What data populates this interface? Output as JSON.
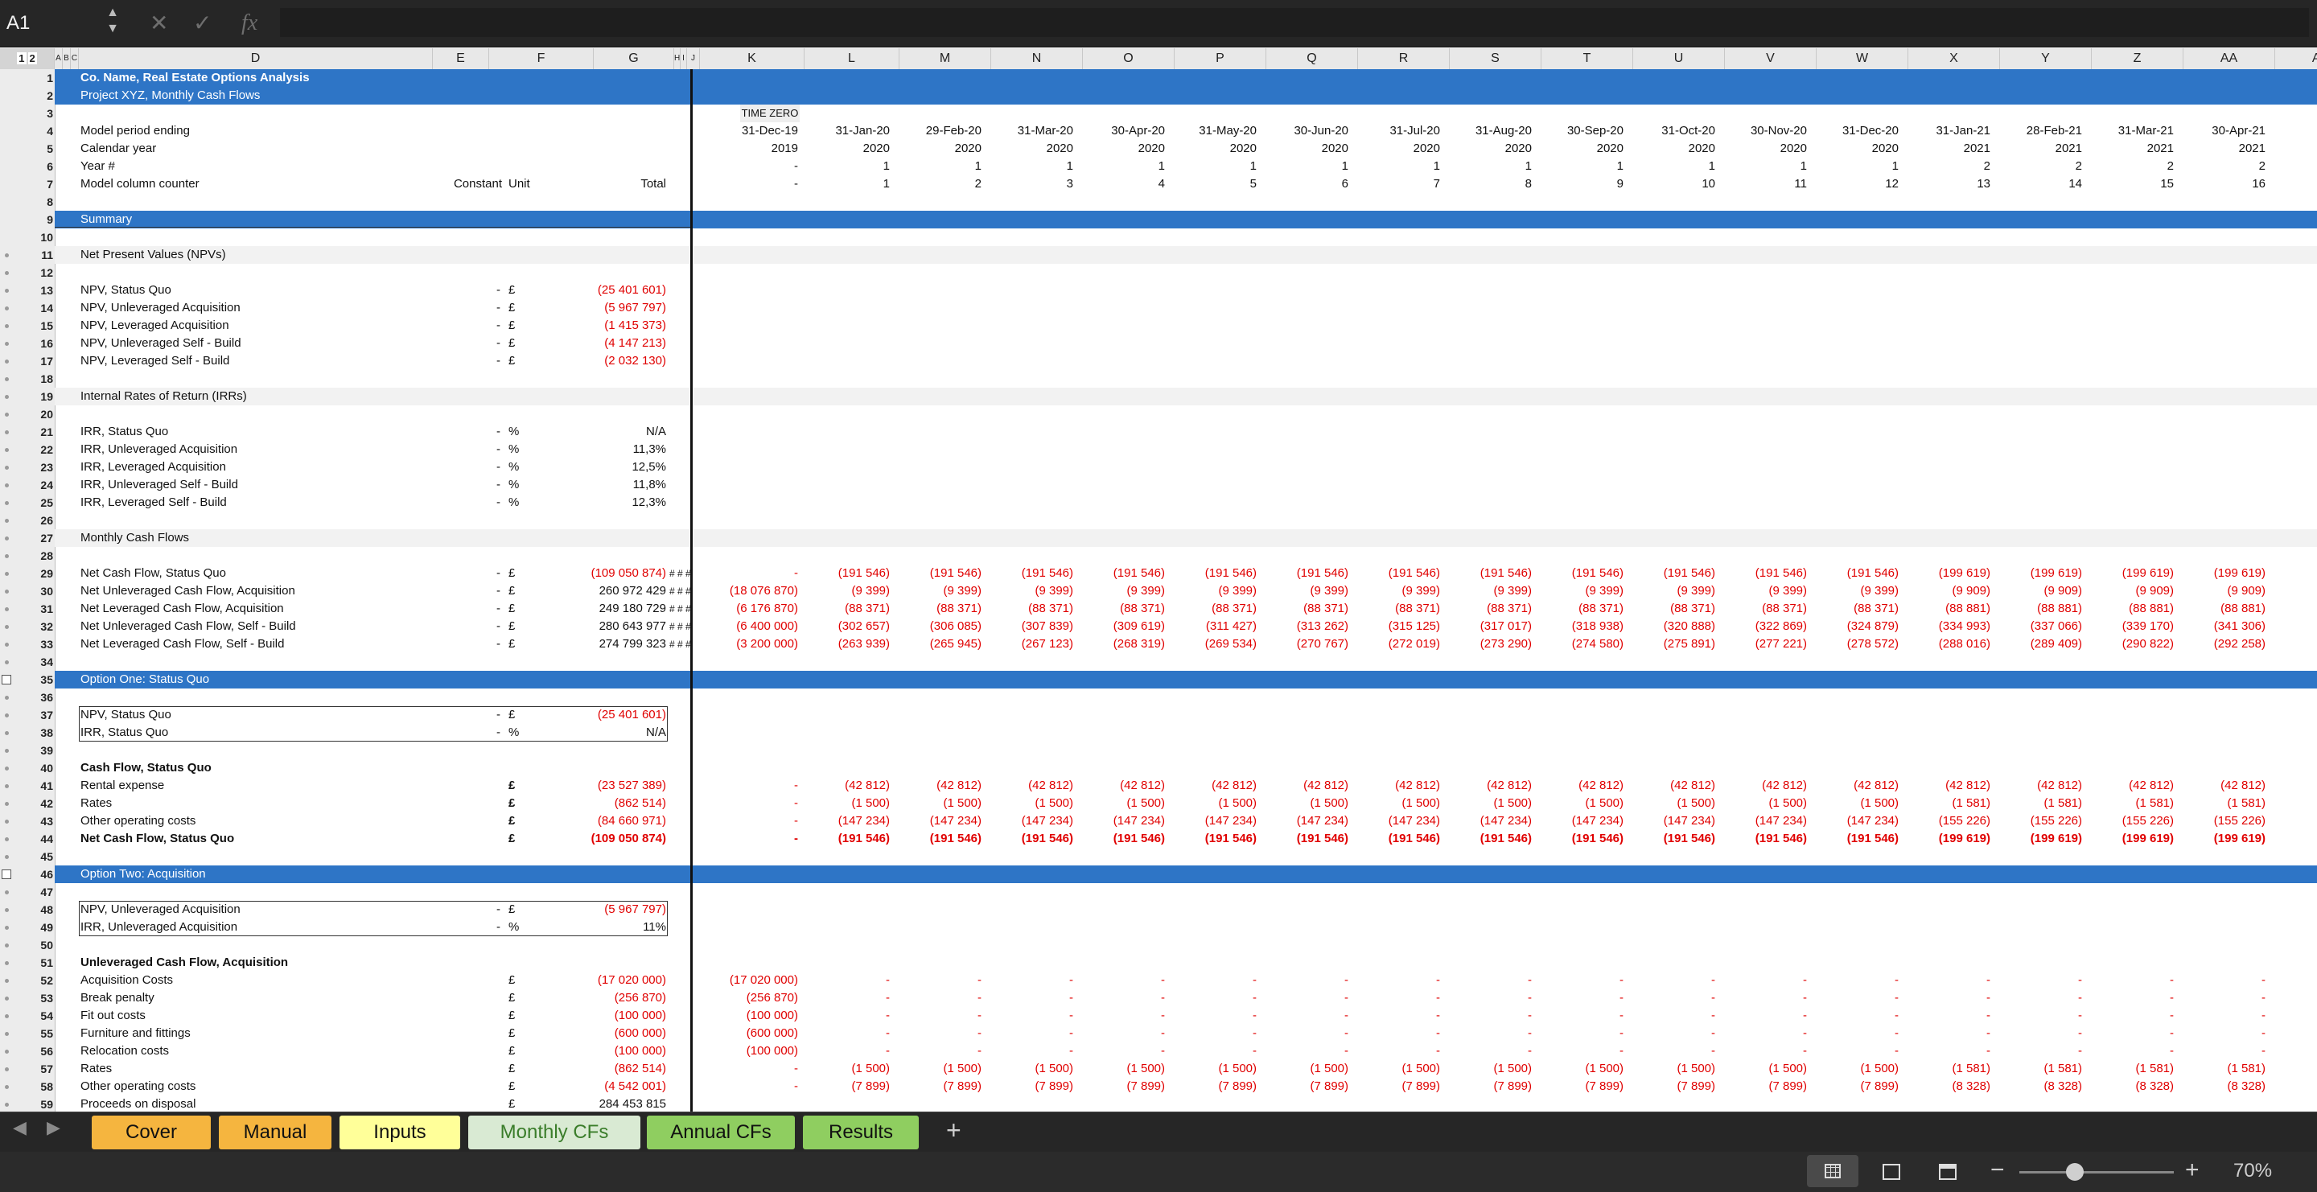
{
  "formula_bar": {
    "name_box": "A1",
    "cancel_icon": "✕",
    "enter_icon": "✓",
    "fx_icon": "fx",
    "formula": ""
  },
  "column_headers": [
    {
      "label": "A"
    },
    {
      "label": "B"
    },
    {
      "label": "C"
    },
    {
      "label": "D"
    },
    {
      "label": "E"
    },
    {
      "label": "F"
    },
    {
      "label": "G"
    },
    {
      "label": "H"
    },
    {
      "label": "I"
    },
    {
      "label": "J"
    },
    {
      "label": "K"
    },
    {
      "label": "L"
    },
    {
      "label": "M"
    },
    {
      "label": "N"
    },
    {
      "label": "O"
    },
    {
      "label": "P"
    },
    {
      "label": "Q"
    },
    {
      "label": "R"
    },
    {
      "label": "S"
    },
    {
      "label": "T"
    },
    {
      "label": "U"
    },
    {
      "label": "V"
    },
    {
      "label": "W"
    },
    {
      "label": "X"
    },
    {
      "label": "Y"
    },
    {
      "label": "Z"
    },
    {
      "label": "AA"
    },
    {
      "label": "AB"
    }
  ],
  "outline_levels": [
    "1",
    "2"
  ],
  "sheet": {
    "row_numbers": [
      "1",
      "2",
      "3",
      "4",
      "5",
      "6",
      "7",
      "8",
      "9",
      "10",
      "11",
      "12",
      "13",
      "14",
      "15",
      "16",
      "17",
      "18",
      "19",
      "20",
      "21",
      "22",
      "23",
      "24",
      "25",
      "26",
      "27",
      "28",
      "29",
      "30",
      "31",
      "32",
      "33",
      "34",
      "35",
      "36",
      "37",
      "38",
      "39",
      "40",
      "41",
      "42",
      "43",
      "44",
      "45",
      "46",
      "47",
      "48",
      "49",
      "50",
      "51",
      "52",
      "53",
      "54",
      "55",
      "56",
      "57",
      "58",
      "59"
    ],
    "title": "Co. Name, Real Estate Options Analysis",
    "subtitle": "Project XYZ, Monthly Cash Flows",
    "time_zero": "TIME ZERO",
    "header_rows": {
      "period_ending": {
        "label": "Model period ending",
        "values": [
          "31-Dec-19",
          "31-Jan-20",
          "29-Feb-20",
          "31-Mar-20",
          "30-Apr-20",
          "31-May-20",
          "30-Jun-20",
          "31-Jul-20",
          "31-Aug-20",
          "30-Sep-20",
          "31-Oct-20",
          "30-Nov-20",
          "31-Dec-20",
          "31-Jan-21",
          "28-Feb-21",
          "31-Mar-21",
          "30-Apr-21"
        ]
      },
      "calendar_year": {
        "label": "Calendar year",
        "values": [
          "2019",
          "2020",
          "2020",
          "2020",
          "2020",
          "2020",
          "2020",
          "2020",
          "2020",
          "2020",
          "2020",
          "2020",
          "2020",
          "2021",
          "2021",
          "2021",
          "2021"
        ]
      },
      "year_num": {
        "label": "Year #",
        "values": [
          "-",
          "1",
          "1",
          "1",
          "1",
          "1",
          "1",
          "1",
          "1",
          "1",
          "1",
          "1",
          "1",
          "2",
          "2",
          "2",
          "2"
        ]
      },
      "counter": {
        "label": "Model column counter",
        "constant": "Constant",
        "unit": "Unit",
        "total": "Total",
        "values": [
          "-",
          "1",
          "2",
          "3",
          "4",
          "5",
          "6",
          "7",
          "8",
          "9",
          "10",
          "11",
          "12",
          "13",
          "14",
          "15",
          "16"
        ]
      }
    },
    "summary": "Summary",
    "npv_head": "Net Present Values (NPVs)",
    "npv": [
      {
        "label": "NPV, Status Quo",
        "const": "-",
        "unit": "£",
        "total": "(25 401 601)"
      },
      {
        "label": "NPV, Unleveraged Acquisition",
        "const": "-",
        "unit": "£",
        "total": "(5 967 797)"
      },
      {
        "label": "NPV, Leveraged Acquisition",
        "const": "-",
        "unit": "£",
        "total": "(1 415 373)"
      },
      {
        "label": "NPV, Unleveraged Self - Build",
        "const": "-",
        "unit": "£",
        "total": "(4 147 213)"
      },
      {
        "label": "NPV, Leveraged Self - Build",
        "const": "-",
        "unit": "£",
        "total": "(2 032 130)"
      }
    ],
    "irr_head": "Internal Rates of Return (IRRs)",
    "irr": [
      {
        "label": "IRR, Status Quo",
        "const": "-",
        "unit": "%",
        "total": "N/A"
      },
      {
        "label": "IRR, Unleveraged Acquisition",
        "const": "-",
        "unit": "%",
        "total": "11,3%"
      },
      {
        "label": "IRR, Leveraged Acquisition",
        "const": "-",
        "unit": "%",
        "total": "12,5%"
      },
      {
        "label": "IRR, Unleveraged Self - Build",
        "const": "-",
        "unit": "%",
        "total": "11,8%"
      },
      {
        "label": "IRR, Leveraged Self - Build",
        "const": "-",
        "unit": "%",
        "total": "12,3%"
      }
    ],
    "mcf_head": "Monthly Cash Flows",
    "mcf": [
      {
        "label": "Net Cash Flow, Status Quo",
        "const": "-",
        "unit": "£",
        "total": "(109 050 874)",
        "hash": "# # #",
        "values": [
          "-",
          "(191 546)",
          "(191 546)",
          "(191 546)",
          "(191 546)",
          "(191 546)",
          "(191 546)",
          "(191 546)",
          "(191 546)",
          "(191 546)",
          "(191 546)",
          "(191 546)",
          "(191 546)",
          "(199 619)",
          "(199 619)",
          "(199 619)",
          "(199 619)"
        ]
      },
      {
        "label": "Net Unleveraged Cash Flow, Acquisition",
        "const": "-",
        "unit": "£",
        "total": "260 972 429",
        "hash": "# # #",
        "values": [
          "(18 076 870)",
          "(9 399)",
          "(9 399)",
          "(9 399)",
          "(9 399)",
          "(9 399)",
          "(9 399)",
          "(9 399)",
          "(9 399)",
          "(9 399)",
          "(9 399)",
          "(9 399)",
          "(9 399)",
          "(9 909)",
          "(9 909)",
          "(9 909)",
          "(9 909)"
        ]
      },
      {
        "label": "Net Leveraged Cash Flow, Acquisition",
        "const": "-",
        "unit": "£",
        "total": "249 180 729",
        "hash": "# # #",
        "values": [
          "(6 176 870)",
          "(88 371)",
          "(88 371)",
          "(88 371)",
          "(88 371)",
          "(88 371)",
          "(88 371)",
          "(88 371)",
          "(88 371)",
          "(88 371)",
          "(88 371)",
          "(88 371)",
          "(88 371)",
          "(88 881)",
          "(88 881)",
          "(88 881)",
          "(88 881)"
        ]
      },
      {
        "label": "Net Unleveraged Cash Flow, Self - Build",
        "const": "-",
        "unit": "£",
        "total": "280 643 977",
        "hash": "# # #",
        "values": [
          "(6 400 000)",
          "(302 657)",
          "(306 085)",
          "(307 839)",
          "(309 619)",
          "(311 427)",
          "(313 262)",
          "(315 125)",
          "(317 017)",
          "(318 938)",
          "(320 888)",
          "(322 869)",
          "(324 879)",
          "(334 993)",
          "(337 066)",
          "(339 170)",
          "(341 306)"
        ]
      },
      {
        "label": "Net Leveraged Cash Flow, Self - Build",
        "const": "-",
        "unit": "£",
        "total": "274 799 323",
        "hash": "# # #",
        "values": [
          "(3 200 000)",
          "(263 939)",
          "(265 945)",
          "(267 123)",
          "(268 319)",
          "(269 534)",
          "(270 767)",
          "(272 019)",
          "(273 290)",
          "(274 580)",
          "(275 891)",
          "(277 221)",
          "(278 572)",
          "(288 016)",
          "(289 409)",
          "(290 822)",
          "(292 258)"
        ]
      }
    ],
    "option1": {
      "band": "Option One: Status Quo",
      "npv": {
        "label": "NPV, Status Quo",
        "const": "-",
        "unit": "£",
        "total": "(25 401 601)"
      },
      "irr": {
        "label": "IRR, Status Quo",
        "const": "-",
        "unit": "%",
        "total": "N/A"
      },
      "cf_head": "Cash Flow, Status Quo",
      "rows": [
        {
          "label": "Rental expense",
          "unit": "£",
          "total": "(23 527 389)",
          "values": [
            "-",
            "(42 812)",
            "(42 812)",
            "(42 812)",
            "(42 812)",
            "(42 812)",
            "(42 812)",
            "(42 812)",
            "(42 812)",
            "(42 812)",
            "(42 812)",
            "(42 812)",
            "(42 812)",
            "(42 812)",
            "(42 812)",
            "(42 812)",
            "(42 812)"
          ]
        },
        {
          "label": "Rates",
          "unit": "£",
          "total": "(862 514)",
          "values": [
            "-",
            "(1 500)",
            "(1 500)",
            "(1 500)",
            "(1 500)",
            "(1 500)",
            "(1 500)",
            "(1 500)",
            "(1 500)",
            "(1 500)",
            "(1 500)",
            "(1 500)",
            "(1 500)",
            "(1 581)",
            "(1 581)",
            "(1 581)",
            "(1 581)"
          ]
        },
        {
          "label": "Other operating costs",
          "unit": "£",
          "total": "(84 660 971)",
          "values": [
            "-",
            "(147 234)",
            "(147 234)",
            "(147 234)",
            "(147 234)",
            "(147 234)",
            "(147 234)",
            "(147 234)",
            "(147 234)",
            "(147 234)",
            "(147 234)",
            "(147 234)",
            "(147 234)",
            "(155 226)",
            "(155 226)",
            "(155 226)",
            "(155 226)"
          ]
        },
        {
          "label": "Net Cash Flow, Status Quo",
          "unit": "£",
          "total": "(109 050 874)",
          "values": [
            "-",
            "(191 546)",
            "(191 546)",
            "(191 546)",
            "(191 546)",
            "(191 546)",
            "(191 546)",
            "(191 546)",
            "(191 546)",
            "(191 546)",
            "(191 546)",
            "(191 546)",
            "(191 546)",
            "(199 619)",
            "(199 619)",
            "(199 619)",
            "(199 619)"
          ]
        }
      ]
    },
    "option2": {
      "band": "Option Two: Acquisition",
      "npv": {
        "label": "NPV, Unleveraged Acquisition",
        "const": "-",
        "unit": "£",
        "total": "(5 967 797)"
      },
      "irr": {
        "label": "IRR, Unleveraged Acquisition",
        "const": "-",
        "unit": "%",
        "total": "11%"
      },
      "cf_head": "Unleveraged Cash Flow, Acquisition",
      "rows": [
        {
          "label": "Acquisition Costs",
          "unit": "£",
          "total": "(17 020 000)",
          "values": [
            "(17 020 000)",
            "-",
            "-",
            "-",
            "-",
            "-",
            "-",
            "-",
            "-",
            "-",
            "-",
            "-",
            "-",
            "-",
            "-",
            "-",
            "-"
          ]
        },
        {
          "label": "Break penalty",
          "unit": "£",
          "total": "(256 870)",
          "values": [
            "(256 870)",
            "-",
            "-",
            "-",
            "-",
            "-",
            "-",
            "-",
            "-",
            "-",
            "-",
            "-",
            "-",
            "-",
            "-",
            "-",
            "-"
          ]
        },
        {
          "label": "Fit out costs",
          "unit": "£",
          "total": "(100 000)",
          "values": [
            "(100 000)",
            "-",
            "-",
            "-",
            "-",
            "-",
            "-",
            "-",
            "-",
            "-",
            "-",
            "-",
            "-",
            "-",
            "-",
            "-",
            "-"
          ]
        },
        {
          "label": "Furniture and fittings",
          "unit": "£",
          "total": "(600 000)",
          "values": [
            "(600 000)",
            "-",
            "-",
            "-",
            "-",
            "-",
            "-",
            "-",
            "-",
            "-",
            "-",
            "-",
            "-",
            "-",
            "-",
            "-",
            "-"
          ]
        },
        {
          "label": "Relocation costs",
          "unit": "£",
          "total": "(100 000)",
          "values": [
            "(100 000)",
            "-",
            "-",
            "-",
            "-",
            "-",
            "-",
            "-",
            "-",
            "-",
            "-",
            "-",
            "-",
            "-",
            "-",
            "-",
            "-"
          ]
        },
        {
          "label": "Rates",
          "unit": "£",
          "total": "(862 514)",
          "values": [
            "-",
            "(1 500)",
            "(1 500)",
            "(1 500)",
            "(1 500)",
            "(1 500)",
            "(1 500)",
            "(1 500)",
            "(1 500)",
            "(1 500)",
            "(1 500)",
            "(1 500)",
            "(1 500)",
            "(1 581)",
            "(1 581)",
            "(1 581)",
            "(1 581)"
          ]
        },
        {
          "label": "Other operating costs",
          "unit": "£",
          "total": "(4 542 001)",
          "values": [
            "-",
            "(7 899)",
            "(7 899)",
            "(7 899)",
            "(7 899)",
            "(7 899)",
            "(7 899)",
            "(7 899)",
            "(7 899)",
            "(7 899)",
            "(7 899)",
            "(7 899)",
            "(7 899)",
            "(8 328)",
            "(8 328)",
            "(8 328)",
            "(8 328)"
          ]
        },
        {
          "label": "Proceeds on disposal",
          "unit": "£",
          "total": "284 453 815",
          "values": []
        }
      ]
    }
  },
  "sheet_tabs": [
    {
      "label": "Cover",
      "color": "#f5b53f",
      "active": false
    },
    {
      "label": "Manual",
      "color": "#f5b53f",
      "active": false
    },
    {
      "label": "Inputs",
      "color": "#ffff99",
      "active": false
    },
    {
      "label": "Monthly CFs",
      "color": "#d9ead3",
      "active": true
    },
    {
      "label": "Annual CFs",
      "color": "#8fce60",
      "active": false
    },
    {
      "label": "Results",
      "color": "#8fce60",
      "active": false
    }
  ],
  "add_sheet_icon": "+",
  "status_bar": {
    "zoom_out": "−",
    "zoom_in": "+",
    "zoom": "70%",
    "zoom_level_pct": 70
  },
  "colors": {
    "band": "#2e75c6",
    "negative": "#e00000",
    "header_bg": "#e8e8e8"
  }
}
